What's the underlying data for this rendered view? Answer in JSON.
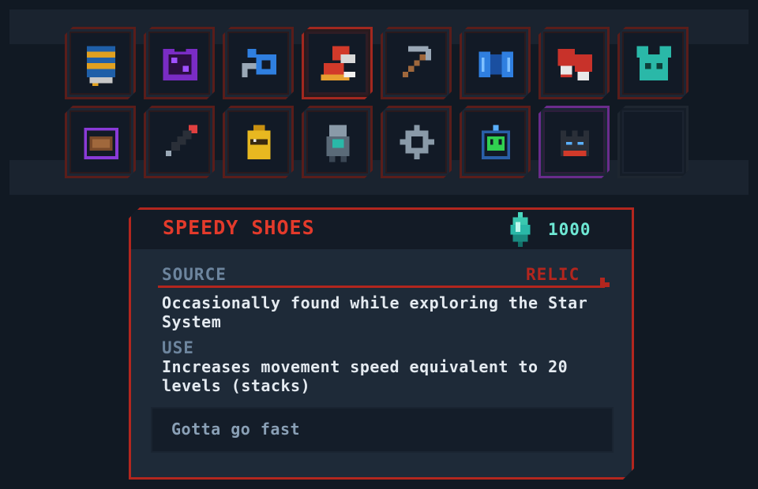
{
  "inventory": {
    "slots": [
      {
        "icon": "blue-scroll-icon"
      },
      {
        "icon": "purple-void-armor-icon"
      },
      {
        "icon": "blue-hose-coil-icon"
      },
      {
        "icon": "speedy-shoes-icon",
        "selected": true
      },
      {
        "icon": "pickaxe-icon"
      },
      {
        "icon": "blue-energy-wings-icon"
      },
      {
        "icon": "red-boxing-gloves-icon"
      },
      {
        "icon": "teal-mouse-icon"
      },
      {
        "icon": "purple-aura-seed-icon"
      },
      {
        "icon": "syringe-icon"
      },
      {
        "icon": "yellow-canister-icon"
      },
      {
        "icon": "grey-robot-suit-icon"
      },
      {
        "icon": "grey-gear-icon"
      },
      {
        "icon": "green-skull-badge-icon"
      },
      {
        "icon": "dark-crown-icon",
        "rarity": "rare"
      },
      {
        "icon": "empty-slot",
        "empty": true
      }
    ]
  },
  "tooltip": {
    "title": "SPEEDY SHOES",
    "cost": "1000",
    "currency_icon": "teal-crystal-icon",
    "source_label": "SOURCE",
    "rarity": "RELIC",
    "source_desc": "Occasionally found while exploring the Star System",
    "use_label": "USE",
    "use_desc": "Increases movement speed equivalent to 20 levels (stacks)",
    "flavor": "Gotta go fast"
  },
  "colors": {
    "accent_red": "#e33a2b",
    "border_red": "#b3261e",
    "cost_teal": "#6ee8d4",
    "rare_purple": "#6a2c8c",
    "background": "#111923"
  }
}
